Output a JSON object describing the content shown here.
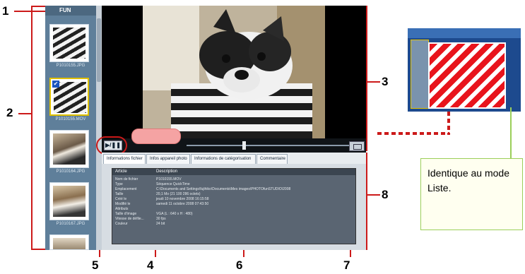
{
  "callouts": [
    "1",
    "2",
    "3",
    "4",
    "5",
    "6",
    "7",
    "8"
  ],
  "sidebar": {
    "title": "FUN",
    "thumbnails": [
      {
        "label": "P1010155.JPG"
      },
      {
        "label": "P1010155.MOV"
      },
      {
        "label": "P1010164.JPG"
      },
      {
        "label": "P1010167.JPG"
      }
    ]
  },
  "player": {
    "play_pause_label": "▶/❚❚"
  },
  "tabs": [
    {
      "label": "Informations fichier"
    },
    {
      "label": "Infos appareil photo"
    },
    {
      "label": "Informations de catégorisation"
    },
    {
      "label": "Commentaire"
    }
  ],
  "info_table": {
    "headers": [
      "Article",
      "Description"
    ],
    "rows": [
      {
        "k": "Nom de fichier",
        "v": "P1010155.MOV"
      },
      {
        "k": "Type",
        "v": "Séquence QuickTime"
      },
      {
        "k": "Emplacement",
        "v": "C:\\Documents and Settings\\fujihiko\\Documents\\Mes images\\PHOTOfunSTUDIO\\2008"
      },
      {
        "k": "Taille",
        "v": "20,1 Mo (21 100 286 octets)"
      },
      {
        "k": "Créé le",
        "v": "jeudi 10 novembre 2008 16:15:58"
      },
      {
        "k": "Modifié le",
        "v": "samedi 11 octobre 2008 07:43:50"
      },
      {
        "k": "Attributs",
        "v": ""
      },
      {
        "k": "Taille d'image",
        "v": "VGA (L : 640 x H : 480)"
      },
      {
        "k": "Vitesse de défile...",
        "v": "30 fps"
      },
      {
        "k": "Couleur",
        "v": "24 bit"
      }
    ]
  },
  "note": {
    "text": "Identique au mode Liste."
  },
  "colors": {
    "callout_line": "#cc1a1a",
    "note_border": "#9bcf5a",
    "hatch_red": "#e8141c"
  }
}
